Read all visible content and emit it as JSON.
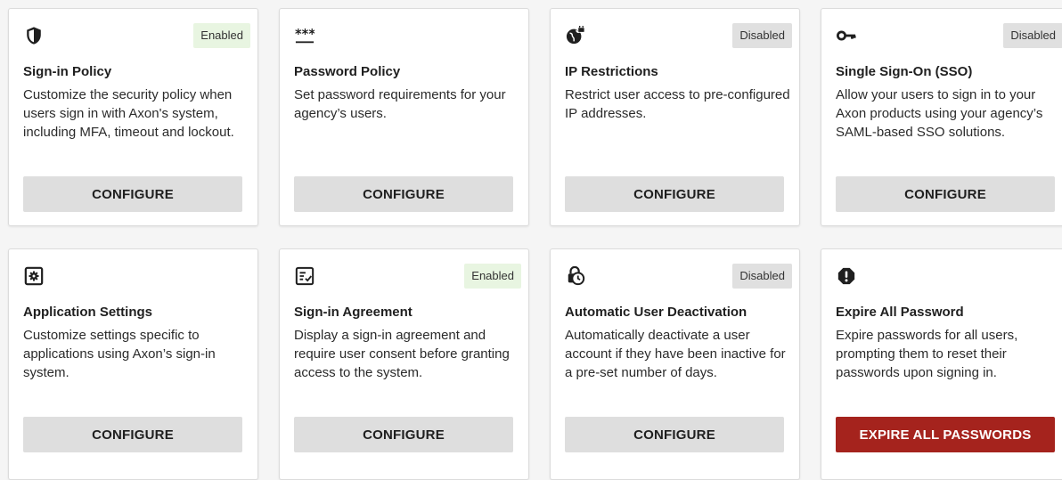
{
  "colors": {
    "enabled_badge_bg": "#e8f5e1",
    "disabled_badge_bg": "#e0e0e0",
    "button_bg": "#dedede",
    "danger_button_bg": "#a5231d"
  },
  "cards": [
    {
      "icon": "shield-icon",
      "badge": "Enabled",
      "title": "Sign-in Policy",
      "description": "Customize the security policy when users sign in with Axon's system, including MFA, timeout and lockout.",
      "button": "CONFIGURE"
    },
    {
      "icon": "password-asterisks-icon",
      "badge": "",
      "title": "Password Policy",
      "description": "Set password requirements for your agency’s users.",
      "button": "CONFIGURE"
    },
    {
      "icon": "globe-lock-icon",
      "badge": "Disabled",
      "title": "IP Restrictions",
      "description": "Restrict user access to pre-configured IP addresses.",
      "button": "CONFIGURE"
    },
    {
      "icon": "key-icon",
      "badge": "Disabled",
      "title": "Single Sign-On (SSO)",
      "description": "Allow your users to sign in to your Axon products using your agency’s SAML-based SSO solutions.",
      "button": "CONFIGURE"
    },
    {
      "icon": "settings-box-icon",
      "badge": "",
      "title": "Application Settings",
      "description": "Customize settings specific to applications using Axon’s sign-in system.",
      "button": "CONFIGURE"
    },
    {
      "icon": "checklist-icon",
      "badge": "Enabled",
      "title": "Sign-in Agreement",
      "description": "Display a sign-in agreement and require user consent before granting access to the system.",
      "button": "CONFIGURE"
    },
    {
      "icon": "lock-clock-icon",
      "badge": "Disabled",
      "title": "Automatic User Deactivation",
      "description": "Automatically deactivate a user account if they have been inactive for a pre-set number of days.",
      "button": "CONFIGURE"
    },
    {
      "icon": "alert-octagon-icon",
      "badge": "",
      "title": "Expire All Password",
      "description": "Expire passwords for all users, prompting them to reset their passwords upon signing in.",
      "button": "EXPIRE ALL PASSWORDS"
    }
  ]
}
